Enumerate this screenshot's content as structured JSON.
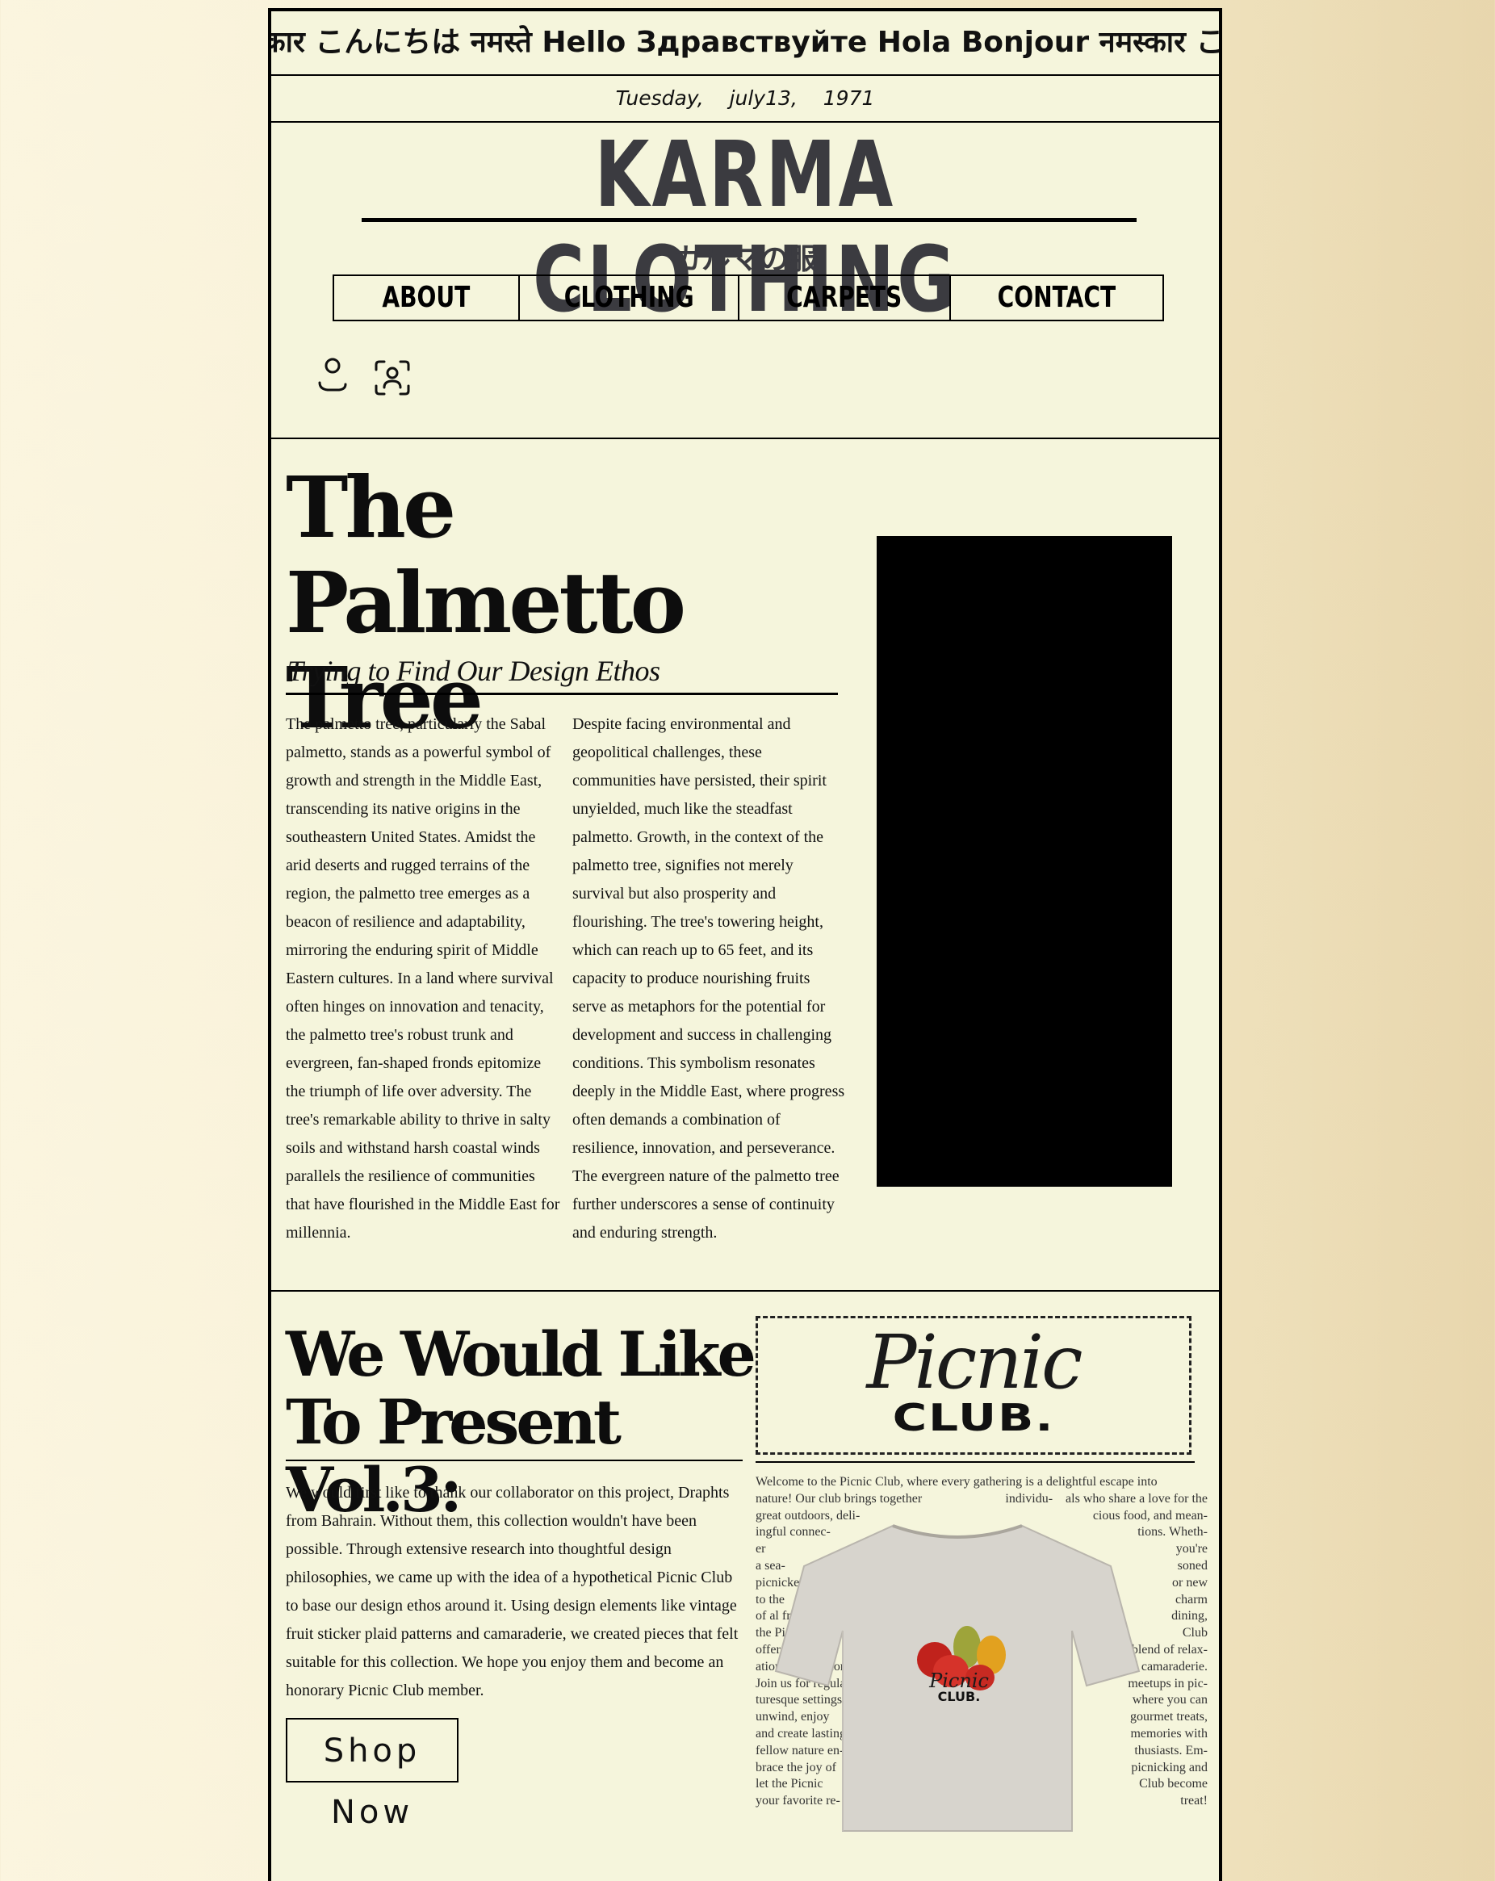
{
  "ticker": "कार こんにちは नमस्ते Hello Здравствуйте Hola Bonjour नमस्कार こん",
  "date": "Tuesday, july13, 1971",
  "brand": {
    "name": "KARMA CLOTHING",
    "subtitle": "カルマの服"
  },
  "nav": {
    "items": [
      "ABOUT",
      "CLOTHING",
      "CARPETS",
      "CONTACT"
    ]
  },
  "icons": [
    "user-icon",
    "face-scan-icon"
  ],
  "article1": {
    "title": "The Palmetto Tree",
    "subtitle": "Trying to Find Our Design Ethos",
    "col1": "The palmetto tree, particularly the Sabal palmetto, stands as a powerful symbol of growth and strength in the Middle East, transcending its native origins in the southeastern United States. Amidst the arid deserts and rugged terrains of the region, the palmetto tree emerges as a beacon of resilience and adaptability, mirroring the enduring spirit of Middle Eastern cultures. In a land where survival often hinges on innovation and tenacity, the palmetto tree's robust trunk and evergreen, fan-shaped fronds epitomize the triumph of life over adversity. The tree's remarkable ability to thrive in salty soils and withstand harsh coastal winds parallels the resilience of communities that have flourished in the Middle East for millennia.",
    "col2": "Despite facing environmental and geopolitical challenges, these communities have persisted, their spirit unyielded, much like the steadfast palmetto. Growth, in the context of the palmetto tree, signifies not merely survival but also prosperity and flourishing. The tree's towering height, which can reach up to 65 feet, and its capacity to produce nourishing fruits serve as metaphors for the potential for development and success in challenging conditions. This symbolism resonates deeply in the Middle East, where progress often demands a combination of resilience, innovation, and perseverance. The evergreen nature of the palmetto tree further underscores a sense of continuity and enduring strength."
  },
  "article2": {
    "title": "We Would Like To Present Vol.3:",
    "intro": "We would first like to thank our collaborator on this project, Draphts from Bahrain. Without them, this collection wouldn't have been possible. Through extensive research into thoughtful design philosophies, we came up with the idea of a hypothetical Picnic Club to base our design ethos around it. Using design elements like vintage fruit sticker plaid patterns and camaraderie, we created pieces that felt suitable for this collection. We hope you enjoy them and become an honorary Picnic Club member.",
    "shop_label": "Shop Now",
    "logo_script": "Picnic",
    "logo_club": "CLUB.",
    "shirt_print_script": "Picnic",
    "shirt_print_club": "CLUB.",
    "picnic_lines_left": [
      "Welcome to the Picnic Club, where every gathering is a delightful escape into",
      "nature! Our club brings together",
      "great outdoors, deli-",
      "ingful connec-",
      "er",
      "a sea-",
      "picnicker",
      "to the",
      "of al fresco",
      "the Picnic",
      "offers a perfect",
      "ation, exploration,",
      "Join us for regular",
      "turesque settings,",
      "unwind, enjoy",
      "and create lasting",
      "fellow nature en-",
      "brace the joy of",
      "let the Picnic",
      "your favorite re-"
    ],
    "picnic_lines_right": [
      "",
      "individu-    als who share a love for the",
      "cious food, and mean-",
      "tions. Wheth-",
      "you're",
      "soned",
      "or new",
      "charm",
      "dining,",
      "Club",
      "blend of relax-",
      "and camaraderie.",
      "meetups in pic-",
      "where you can",
      "gourmet treats,",
      "memories with",
      "thusiasts. Em-",
      "picnicking and",
      "Club become",
      "treat!"
    ]
  }
}
